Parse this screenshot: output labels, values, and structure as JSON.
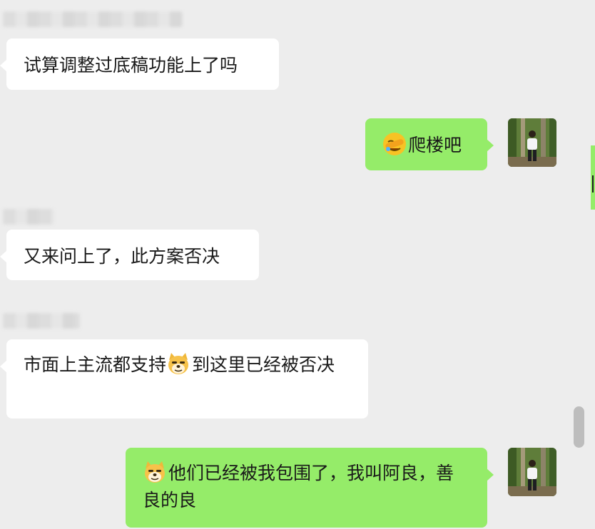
{
  "messages": [
    {
      "side": "left",
      "text": "试算调整过底稿功能上了吗"
    },
    {
      "side": "right",
      "emoji": "facepalm-emoji",
      "text": "爬楼吧"
    },
    {
      "side": "left",
      "text": "又来问上了，此方案否决"
    },
    {
      "side": "left",
      "text_before": "市面上主流都支持",
      "emoji": "doge-emoji",
      "text_after": "到这里已经被否决"
    },
    {
      "side": "right",
      "emoji": "doge-emoji",
      "text": "他们已经被我包围了，我叫阿良，善良的良"
    }
  ],
  "colors": {
    "background": "#ededed",
    "incoming_bubble": "#ffffff",
    "outgoing_bubble": "#95ec69"
  }
}
